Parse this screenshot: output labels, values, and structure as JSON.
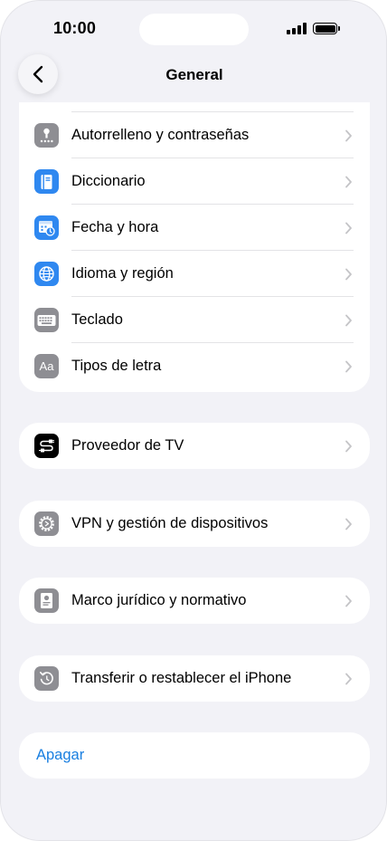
{
  "status_bar": {
    "time": "10:00"
  },
  "nav": {
    "title": "General"
  },
  "settings": {
    "group1": [
      {
        "label": "Autorrelleno y contraseñas",
        "icon": "key-icon"
      },
      {
        "label": "Diccionario",
        "icon": "book-icon"
      },
      {
        "label": "Fecha y hora",
        "icon": "calendar-clock-icon"
      },
      {
        "label": "Idioma y región",
        "icon": "globe-icon"
      },
      {
        "label": "Teclado",
        "icon": "keyboard-icon"
      },
      {
        "label": "Tipos de letra",
        "icon": "font-icon",
        "icon_text": "Aa"
      }
    ],
    "tv_provider": {
      "label": "Proveedor de TV",
      "icon": "tv-provider-icon"
    },
    "vpn": {
      "label": "VPN y gestión de dispositivos",
      "icon": "gear-icon"
    },
    "legal": {
      "label": "Marco jurídico y normativo",
      "icon": "certificate-icon"
    },
    "reset": {
      "label": "Transferir o restablecer el iPhone",
      "icon": "reset-icon"
    },
    "shutdown": {
      "label": "Apagar"
    }
  },
  "colors": {
    "accent": "#1a7fe0",
    "background": "#f2f2f7",
    "blue_icon": "#2f88f0",
    "gray_icon": "#8e8e93"
  }
}
